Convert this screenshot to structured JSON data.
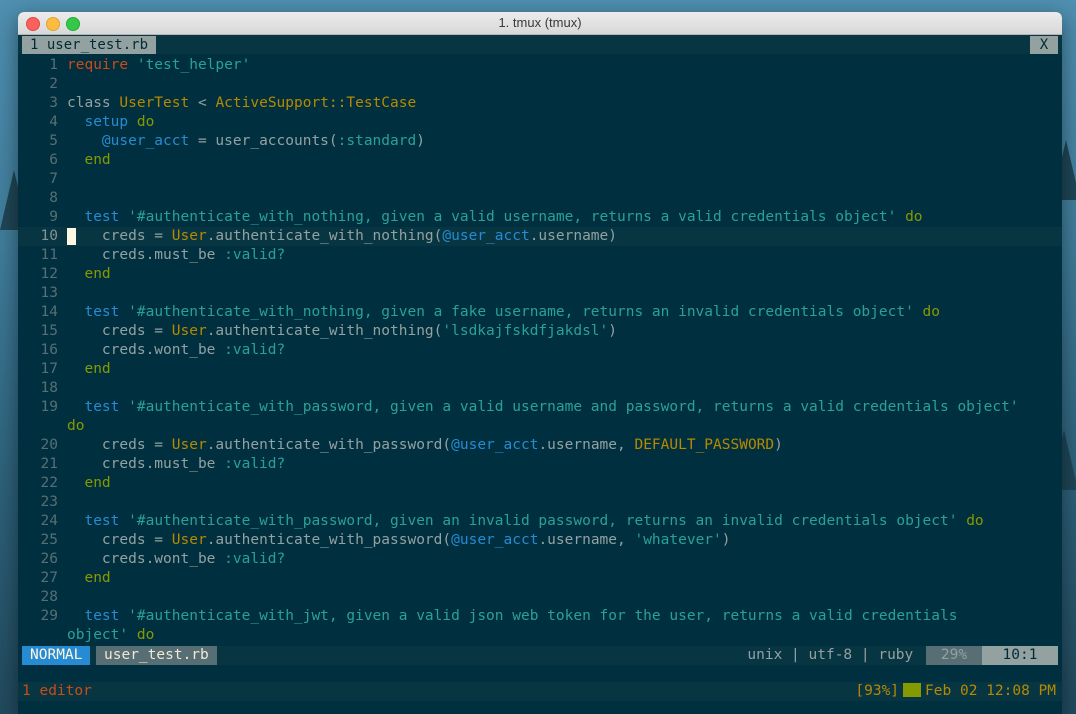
{
  "window": {
    "title": "1. tmux (tmux)"
  },
  "vim_tab": {
    "label": "1 user_test.rb",
    "close_label": "X"
  },
  "editor": {
    "lines": [
      {
        "n": "1",
        "segs": [
          [
            "kw",
            "require"
          ],
          [
            "def",
            " "
          ],
          [
            "str",
            "'test_helper'"
          ]
        ]
      },
      {
        "n": "2",
        "segs": []
      },
      {
        "n": "3",
        "segs": [
          [
            "def",
            "class "
          ],
          [
            "cls",
            "UserTest"
          ],
          [
            "def",
            " < "
          ],
          [
            "cls",
            "ActiveSupport::TestCase"
          ]
        ]
      },
      {
        "n": "4",
        "segs": [
          [
            "def",
            "  "
          ],
          [
            "ivar",
            "setup"
          ],
          [
            "def",
            " "
          ],
          [
            "kw2",
            "do"
          ]
        ]
      },
      {
        "n": "5",
        "segs": [
          [
            "def",
            "    "
          ],
          [
            "ivar",
            "@user_acct"
          ],
          [
            "def",
            " = user_accounts("
          ],
          [
            "sym",
            ":standard"
          ],
          [
            "def",
            ")"
          ]
        ]
      },
      {
        "n": "6",
        "segs": [
          [
            "def",
            "  "
          ],
          [
            "kw2",
            "end"
          ]
        ]
      },
      {
        "n": "7",
        "segs": []
      },
      {
        "n": "8",
        "segs": []
      },
      {
        "n": "9",
        "segs": [
          [
            "def",
            "  "
          ],
          [
            "ivar",
            "test"
          ],
          [
            "def",
            " "
          ],
          [
            "str",
            "'#authenticate_with_nothing, given a valid username, returns a valid credentials object'"
          ],
          [
            "def",
            " "
          ],
          [
            "kw2",
            "do"
          ]
        ]
      },
      {
        "n": "10",
        "cursor": true,
        "segs": [
          [
            "def",
            "    creds = "
          ],
          [
            "cls",
            "User"
          ],
          [
            "def",
            ".authenticate_with_nothing("
          ],
          [
            "ivar",
            "@user_acct"
          ],
          [
            "def",
            ".username)"
          ]
        ]
      },
      {
        "n": "11",
        "segs": [
          [
            "def",
            "    creds.must_be "
          ],
          [
            "sym",
            ":valid?"
          ]
        ]
      },
      {
        "n": "12",
        "segs": [
          [
            "def",
            "  "
          ],
          [
            "kw2",
            "end"
          ]
        ]
      },
      {
        "n": "13",
        "segs": []
      },
      {
        "n": "14",
        "segs": [
          [
            "def",
            "  "
          ],
          [
            "ivar",
            "test"
          ],
          [
            "def",
            " "
          ],
          [
            "str",
            "'#authenticate_with_nothing, given a fake username, returns an invalid credentials object'"
          ],
          [
            "def",
            " "
          ],
          [
            "kw2",
            "do"
          ]
        ]
      },
      {
        "n": "15",
        "segs": [
          [
            "def",
            "    creds = "
          ],
          [
            "cls",
            "User"
          ],
          [
            "def",
            ".authenticate_with_nothing("
          ],
          [
            "str",
            "'lsdkajfskdfjakdsl'"
          ],
          [
            "def",
            ")"
          ]
        ]
      },
      {
        "n": "16",
        "segs": [
          [
            "def",
            "    creds.wont_be "
          ],
          [
            "sym",
            ":valid?"
          ]
        ]
      },
      {
        "n": "17",
        "segs": [
          [
            "def",
            "  "
          ],
          [
            "kw2",
            "end"
          ]
        ]
      },
      {
        "n": "18",
        "segs": []
      },
      {
        "n": "19",
        "segs": [
          [
            "def",
            "  "
          ],
          [
            "ivar",
            "test"
          ],
          [
            "def",
            " "
          ],
          [
            "str",
            "'#authenticate_with_password, given a valid username and password, returns a valid credentials object'"
          ]
        ]
      },
      {
        "n": "",
        "segs": [
          [
            "kw2",
            "do"
          ]
        ]
      },
      {
        "n": "20",
        "segs": [
          [
            "def",
            "    creds = "
          ],
          [
            "cls",
            "User"
          ],
          [
            "def",
            ".authenticate_with_password("
          ],
          [
            "ivar",
            "@user_acct"
          ],
          [
            "def",
            ".username, "
          ],
          [
            "const",
            "DEFAULT_PASSWORD"
          ],
          [
            "def",
            ")"
          ]
        ]
      },
      {
        "n": "21",
        "segs": [
          [
            "def",
            "    creds.must_be "
          ],
          [
            "sym",
            ":valid?"
          ]
        ]
      },
      {
        "n": "22",
        "segs": [
          [
            "def",
            "  "
          ],
          [
            "kw2",
            "end"
          ]
        ]
      },
      {
        "n": "23",
        "segs": []
      },
      {
        "n": "24",
        "segs": [
          [
            "def",
            "  "
          ],
          [
            "ivar",
            "test"
          ],
          [
            "def",
            " "
          ],
          [
            "str",
            "'#authenticate_with_password, given an invalid password, returns an invalid credentials object'"
          ],
          [
            "def",
            " "
          ],
          [
            "kw2",
            "do"
          ]
        ]
      },
      {
        "n": "25",
        "segs": [
          [
            "def",
            "    creds = "
          ],
          [
            "cls",
            "User"
          ],
          [
            "def",
            ".authenticate_with_password("
          ],
          [
            "ivar",
            "@user_acct"
          ],
          [
            "def",
            ".username, "
          ],
          [
            "str",
            "'whatever'"
          ],
          [
            "def",
            ")"
          ]
        ]
      },
      {
        "n": "26",
        "segs": [
          [
            "def",
            "    creds.wont_be "
          ],
          [
            "sym",
            ":valid?"
          ]
        ]
      },
      {
        "n": "27",
        "segs": [
          [
            "def",
            "  "
          ],
          [
            "kw2",
            "end"
          ]
        ]
      },
      {
        "n": "28",
        "segs": []
      },
      {
        "n": "29",
        "segs": [
          [
            "def",
            "  "
          ],
          [
            "ivar",
            "test"
          ],
          [
            "def",
            " "
          ],
          [
            "str",
            "'#authenticate_with_jwt, given a valid json web token for the user, returns a valid credentials"
          ]
        ]
      },
      {
        "n": "",
        "segs": [
          [
            "str",
            "object'"
          ],
          [
            "def",
            " "
          ],
          [
            "kw2",
            "do"
          ]
        ]
      }
    ]
  },
  "statusline": {
    "mode": "NORMAL",
    "filename": "user_test.rb",
    "fileinfo": "unix | utf-8 | ruby ",
    "percent": "29%",
    "position": "10:1"
  },
  "tmux": {
    "window_label": "1 editor",
    "battery": "[93%]",
    "datetime": "Feb 02 12:08 PM"
  },
  "colors": {
    "background": "#00303f",
    "mode_bg": "#268bd2",
    "keyword": "#cb4b16",
    "string": "#2aa198",
    "class": "#b58900"
  }
}
